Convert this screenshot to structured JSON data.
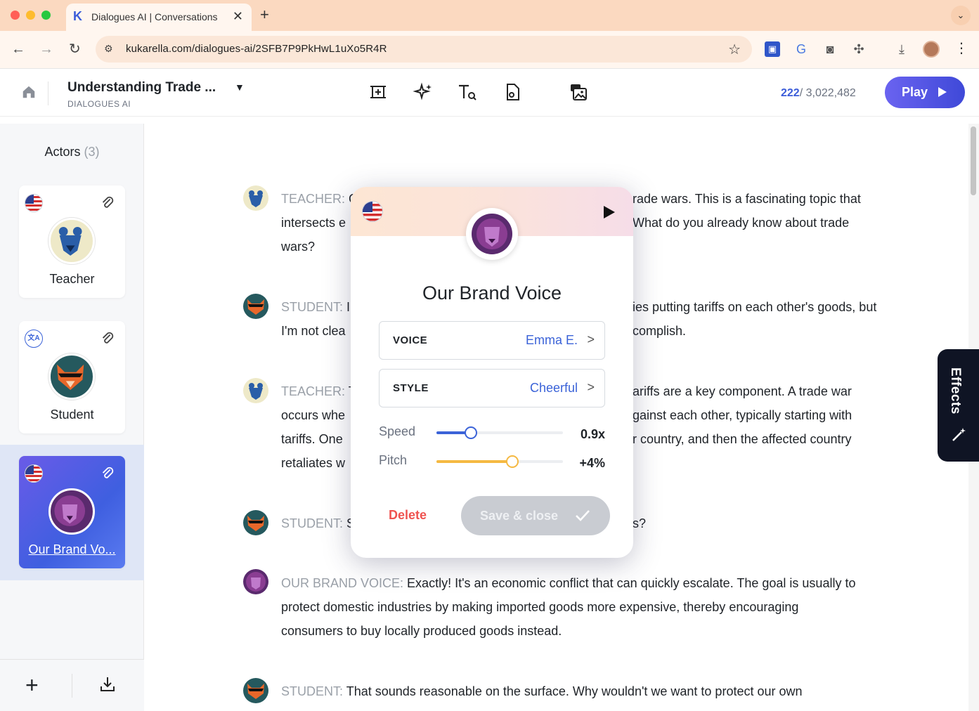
{
  "browser": {
    "tab_title": "Dialogues AI | Conversations",
    "tab_close": "✕",
    "new_tab": "+",
    "url": "kukarella.com/dialogues-ai/2SFB7P9PkHwL1uXo5R4R"
  },
  "header": {
    "title": "Understanding Trade ...",
    "subtitle": "DIALOGUES AI",
    "char_used": "222",
    "char_total": "/ 3,022,482",
    "play_label": "Play"
  },
  "sidebar": {
    "title": "Actors",
    "count": "(3)",
    "actors": [
      {
        "name": "Teacher",
        "flag": "us-flag"
      },
      {
        "name": "Student",
        "flag": "translate-icon"
      },
      {
        "name": "Our Brand Vo...",
        "flag": "us-flag",
        "selected": true
      }
    ]
  },
  "lines": [
    {
      "speaker": "TEACHER:",
      "text": "C",
      "text_right": "rade wars. This is a fascinating topic that",
      "l2": "intersects e",
      "l2r": "What do you already know about trade",
      "l3": "wars?"
    },
    {
      "speaker": "STUDENT:",
      "text": "I",
      "text_right": "ies putting tariffs on each other's goods, but",
      "l2": "I'm not clea",
      "l2r": "complish."
    },
    {
      "speaker": "TEACHER:",
      "text": "T",
      "text_right": "ariffs are a key component. A trade war",
      "l2": "occurs whe",
      "l2r": "gainst each other, typically starting with",
      "l3": "tariffs. One",
      "l3r": "r country, and then the affected country",
      "l4": "retaliates w"
    },
    {
      "speaker": "STUDENT:",
      "text": "S",
      "text_right": "s?"
    },
    {
      "speaker": "OUR BRAND VOICE:",
      "text": "Exactly! It's an economic conflict that can quickly escalate. The goal is usually to",
      "l2": "protect domestic industries by making imported goods more expensive, thereby encouraging",
      "l3": "consumers to buy locally produced goods instead."
    },
    {
      "speaker": "STUDENT:",
      "text": "That sounds reasonable on the surface. Why wouldn't we want to protect our own"
    }
  ],
  "effects_label": "Effects",
  "modal": {
    "title": "Our Brand Voice",
    "voice_label": "VOICE",
    "voice_value": "Emma E.",
    "style_label": "STYLE",
    "style_value": "Cheerful",
    "speed_label": "Speed",
    "speed_value": "0.9x",
    "speed_fraction": 0.27,
    "pitch_label": "Pitch",
    "pitch_value": "+4%",
    "pitch_fraction": 0.6,
    "delete_label": "Delete",
    "save_label": "Save & close"
  },
  "colors": {
    "accent": "#3b63d8",
    "speed": "#3b63d8",
    "pitch": "#f5b942",
    "danger": "#ef5350"
  }
}
